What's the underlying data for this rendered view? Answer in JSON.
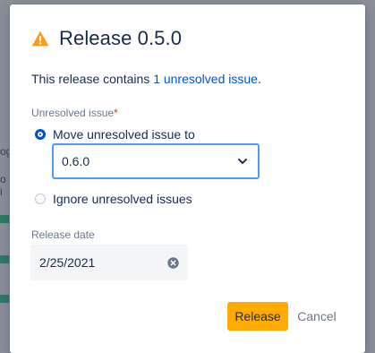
{
  "background": {
    "fragment_text_1": "og",
    "fragment_text_2": "o i"
  },
  "dialog": {
    "title": "Release 0.5.0",
    "title_icon": "warning-icon",
    "summary_prefix": "This release contains ",
    "summary_link": "1 unresolved issue",
    "summary_suffix": "."
  },
  "unresolved": {
    "label": "Unresolved issue",
    "required_marker": "*",
    "options": [
      {
        "label": "Move unresolved issue to",
        "selected": true
      },
      {
        "label": "Ignore unresolved issues",
        "selected": false
      }
    ],
    "target_version": "0.6.0"
  },
  "release_date": {
    "label": "Release date",
    "value": "2/25/2021"
  },
  "actions": {
    "release_label": "Release",
    "cancel_label": "Cancel"
  },
  "colors": {
    "warning": "#ff991f",
    "link": "#0052cc",
    "primary_button": "#ffab00",
    "focus_border": "#4c9aff",
    "required": "#de350b"
  }
}
